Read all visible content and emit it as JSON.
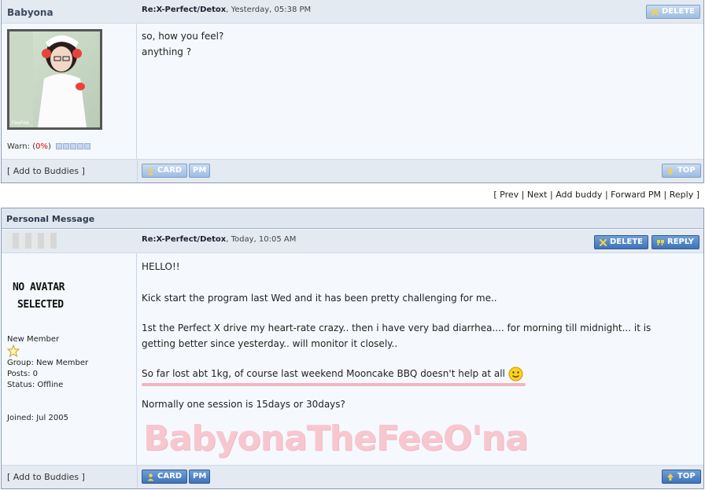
{
  "post1": {
    "username": "Babyona",
    "subject": "Re:X-Perfect/Detox",
    "time": ", Yesterday, 05:38 PM",
    "delete_label": "DELETE",
    "lines": [
      "so, how you feel?",
      "anything ?"
    ],
    "warn_label": "Warn: (",
    "warn_value": "0%",
    "warn_close": ")",
    "add_buddies": "[ Add to Buddies ]",
    "card_label": "CARD",
    "pm_label": "PM",
    "top_label": "TOP"
  },
  "nav": {
    "open": "[",
    "prev": "Prev",
    "next": "Next",
    "add_buddy": "Add buddy",
    "forward_pm": "Forward PM",
    "reply": "Reply",
    "close": "]",
    "sep": "|"
  },
  "post2": {
    "section_title": "Personal Message",
    "subject": "Re:X-Perfect/Detox",
    "time": ", Today, 10:05 AM",
    "delete_label": "DELETE",
    "reply_label": "REPLY",
    "no_avatar_line1": "NO AVATAR",
    "no_avatar_line2": "SELECTED",
    "member_title": "New Member",
    "group": "Group: New Member",
    "posts": "Posts: 0",
    "status": "Status: Offline",
    "joined": "Joined: Jul 2005",
    "lines": [
      "HELLO!!",
      "Kick start the program last Wed and it has been pretty challenging for me..",
      "1st the Perfect X drive my heart-rate crazy.. then i have very bad diarrhea.... for morning till midnight... it is",
      "getting better since yesterday.. will monitor it closely..",
      "So far lost abt 1kg, of course last weekend Mooncake BBQ doesn't help at all",
      "Normally one session is 15days or 30days?"
    ],
    "watermark": "BabyonaTheFeeO'na",
    "add_buddies": "[ Add to Buddies ]",
    "card_label": "CARD",
    "pm_label": "PM",
    "top_label": "TOP"
  },
  "icons": {
    "delete": "x-icon",
    "reply": "quote-icon",
    "card": "user-icon",
    "top": "arrow-up-icon",
    "star": "star-icon",
    "smiley": "smiley-icon"
  },
  "colors": {
    "button_blue": "#3f73b8",
    "button_light": "#9dbce0",
    "warn_red": "#dd0000",
    "watermark_pink": "#f7c7cf",
    "post_bg": "#f5f9fd"
  }
}
